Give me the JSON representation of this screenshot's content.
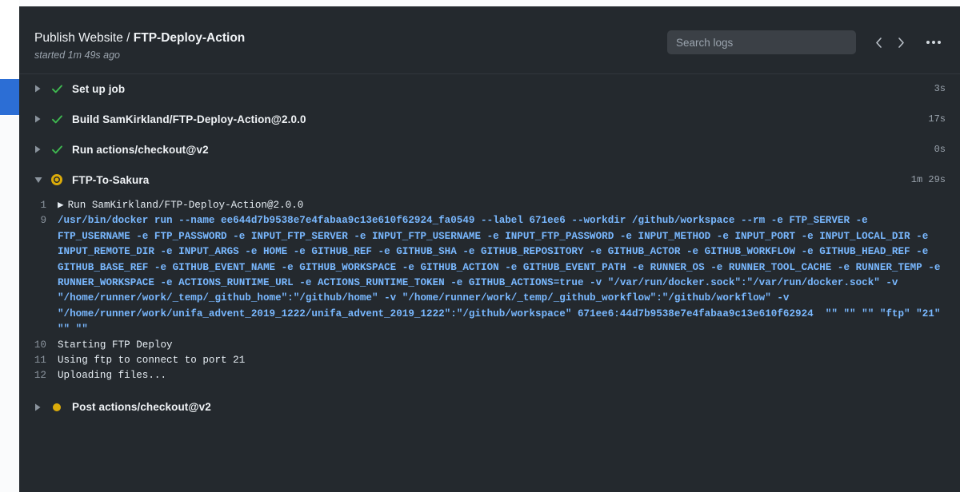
{
  "colors": {
    "panel_bg": "#24292e",
    "rail_selection": "#2c6ed5",
    "success": "#3fb950",
    "in_progress": "#dbab0a",
    "command_text": "#79b8ff"
  },
  "header": {
    "workflow_name": "Publish Website",
    "separator": " / ",
    "job_name": "FTP-Deploy-Action",
    "subtitle": "started 1m 49s ago",
    "search": {
      "placeholder": "Search logs",
      "value": ""
    },
    "prev_icon": "chevron-left-icon",
    "next_icon": "chevron-right-icon",
    "menu_icon": "kebab-menu-icon"
  },
  "steps": [
    {
      "name": "Set up job",
      "duration": "3s",
      "status": "success",
      "expanded": false
    },
    {
      "name": "Build SamKirkland/FTP-Deploy-Action@2.0.0",
      "duration": "17s",
      "status": "success",
      "expanded": false
    },
    {
      "name": "Run actions/checkout@v2",
      "duration": "0s",
      "status": "success",
      "expanded": false
    },
    {
      "name": "FTP-To-Sakura",
      "duration": "1m 29s",
      "status": "in_progress",
      "expanded": true
    },
    {
      "name": "Post actions/checkout@v2",
      "duration": "",
      "status": "queued",
      "expanded": false
    }
  ],
  "log": {
    "lines": [
      {
        "number": "1",
        "text": "Run SamKirkland/FTP-Deploy-Action@2.0.0",
        "style": "plain",
        "has_caret": true
      },
      {
        "number": "9",
        "text": "/usr/bin/docker run --name ee644d7b9538e7e4fabaa9c13e610f62924_fa0549 --label 671ee6 --workdir /github/workspace --rm -e FTP_SERVER -e FTP_USERNAME -e FTP_PASSWORD -e INPUT_FTP_SERVER -e INPUT_FTP_USERNAME -e INPUT_FTP_PASSWORD -e INPUT_METHOD -e INPUT_PORT -e INPUT_LOCAL_DIR -e INPUT_REMOTE_DIR -e INPUT_ARGS -e HOME -e GITHUB_REF -e GITHUB_SHA -e GITHUB_REPOSITORY -e GITHUB_ACTOR -e GITHUB_WORKFLOW -e GITHUB_HEAD_REF -e GITHUB_BASE_REF -e GITHUB_EVENT_NAME -e GITHUB_WORKSPACE -e GITHUB_ACTION -e GITHUB_EVENT_PATH -e RUNNER_OS -e RUNNER_TOOL_CACHE -e RUNNER_TEMP -e RUNNER_WORKSPACE -e ACTIONS_RUNTIME_URL -e ACTIONS_RUNTIME_TOKEN -e GITHUB_ACTIONS=true -v \"/var/run/docker.sock\":\"/var/run/docker.sock\" -v \"/home/runner/work/_temp/_github_home\":\"/github/home\" -v \"/home/runner/work/_temp/_github_workflow\":\"/github/workflow\" -v \"/home/runner/work/unifa_advent_2019_1222/unifa_advent_2019_1222\":\"/github/workspace\" 671ee6:44d7b9538e7e4fabaa9c13e610f62924  \"\" \"\" \"\" \"ftp\" \"21\" \"\" \"\"",
        "style": "command",
        "has_caret": false
      },
      {
        "number": "10",
        "text": "Starting FTP Deploy",
        "style": "plain",
        "has_caret": false
      },
      {
        "number": "11",
        "text": "Using ftp to connect to port 21",
        "style": "plain",
        "has_caret": false
      },
      {
        "number": "12",
        "text": "Uploading files...",
        "style": "plain",
        "has_caret": false
      }
    ]
  }
}
